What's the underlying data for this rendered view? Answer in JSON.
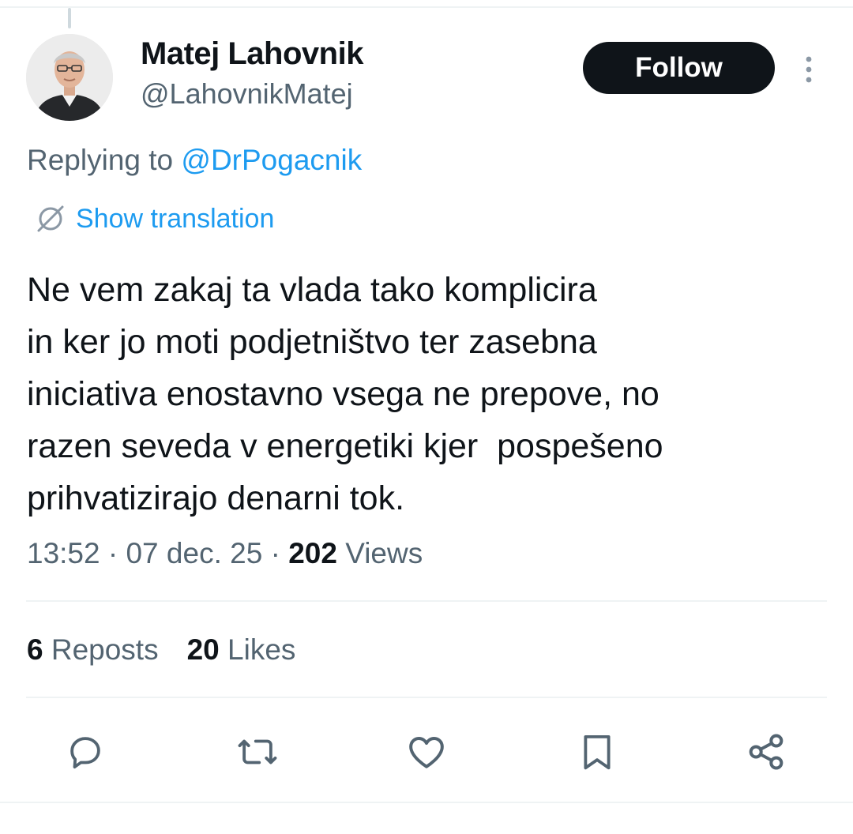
{
  "user": {
    "display_name": "Matej Lahovnik",
    "handle": "@LahovnikMatej",
    "avatar_icon": "profile-photo"
  },
  "follow_label": "Follow",
  "more_icon": "more-vertical-icon",
  "reply": {
    "prefix": "Replying to ",
    "mention": "@DrPogacnik"
  },
  "translate_label": "Show translation",
  "tweet_text": "Ne vem zakaj ta vlada tako komplicira\nin ker jo moti podjetništvo ter zasebna\niniciativa enostavno vsega ne prepove, no\nrazen seveda v energetiki kjer  pospešeno\nprihvatizirajo denarni tok.",
  "meta": {
    "time": "13:52",
    "separator": " · ",
    "date": "07 dec. 25",
    "views_count": "202",
    "views_label": " Views"
  },
  "stats": {
    "reposts_count": "6",
    "reposts_label": " Reposts",
    "likes_count": "20",
    "likes_label": " Likes"
  },
  "actions": [
    "reply-icon",
    "repost-icon",
    "like-icon",
    "bookmark-icon",
    "share-icon"
  ],
  "colors": {
    "text_primary": "#0f1419",
    "text_secondary": "#536471",
    "link": "#1d9bf0",
    "button_bg": "#0f1419",
    "border": "#eff3f4"
  }
}
